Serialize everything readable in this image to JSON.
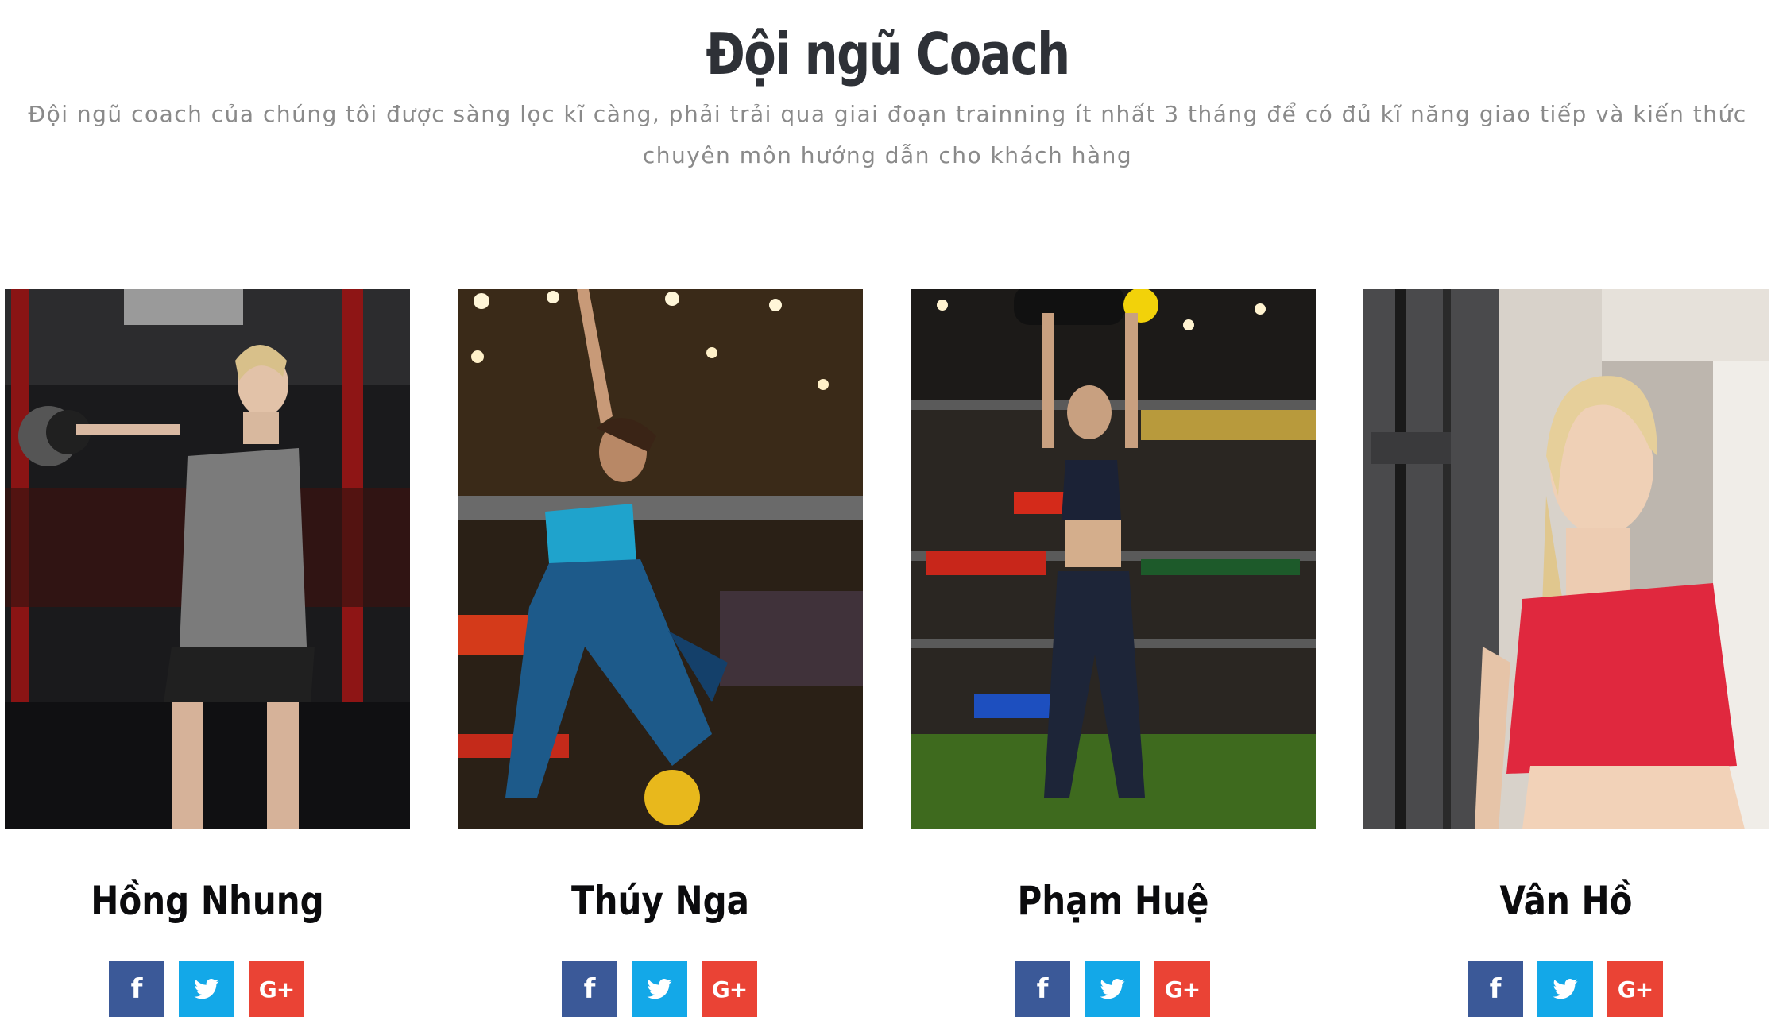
{
  "section": {
    "title": "Đội ngũ Coach",
    "description": "Đội ngũ coach của chúng tôi được sàng lọc kĩ càng, phải trải qua giai đoạn trainning ít nhất 3 tháng để có đủ kĩ năng giao tiếp và kiến thức chuyên môn hướng dẫn cho khách hàng"
  },
  "social_icons": {
    "facebook": {
      "icon": "facebook-icon",
      "glyph": "f",
      "color": "#3b5998"
    },
    "twitter": {
      "icon": "twitter-icon",
      "color": "#13a8e8"
    },
    "googleplus": {
      "icon": "google-plus-icon",
      "glyph": "G+",
      "color": "#ea4335"
    }
  },
  "coaches": [
    {
      "name": "Hồng Nhung"
    },
    {
      "name": "Thúy Nga"
    },
    {
      "name": "Phạm Huệ"
    },
    {
      "name": "Vân Hồ"
    }
  ]
}
